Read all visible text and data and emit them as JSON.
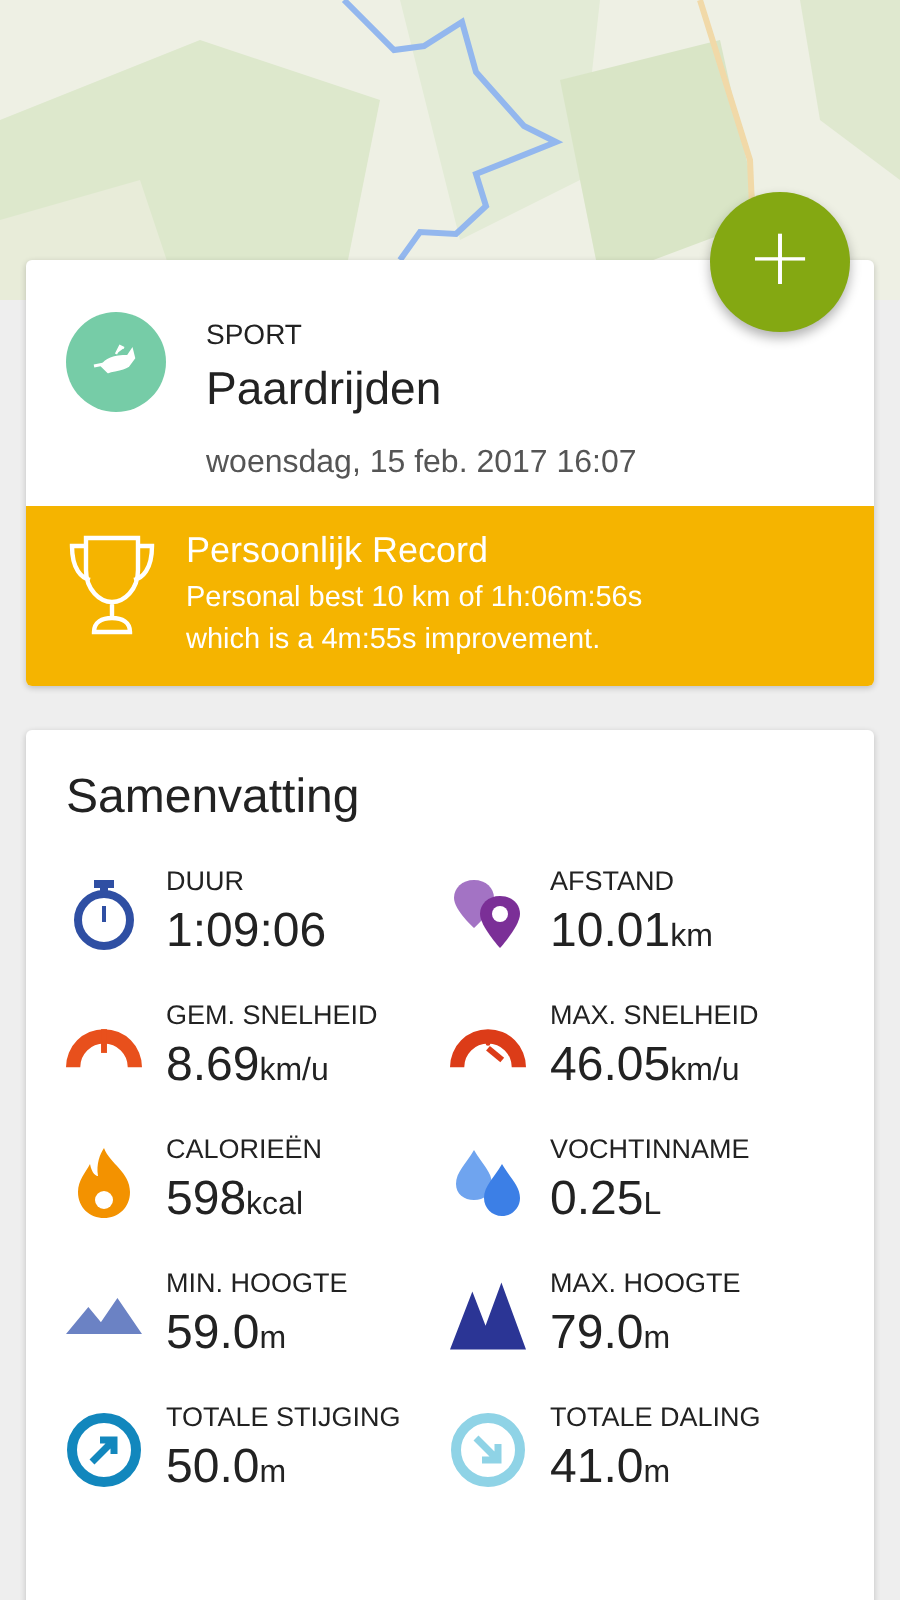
{
  "fab": {
    "symbol": "+"
  },
  "activity": {
    "label": "SPORT",
    "sport": "Paardrijden",
    "date": "woensdag, 15 feb. 2017 16:07"
  },
  "record": {
    "title": "Persoonlijk Record",
    "text": "Personal best 10 km of 1h:06m:56s which is a 4m:55s improvement."
  },
  "summary": {
    "title": "Samenvatting",
    "stats": [
      {
        "kind": "duration",
        "label": "DUUR",
        "value": "1:09:06"
      },
      {
        "kind": "distance",
        "label": "AFSTAND",
        "value": "10.01",
        "unit": "km"
      },
      {
        "kind": "avg-speed",
        "label": "GEM. SNELHEID",
        "value": "8.69",
        "unit": "km/u"
      },
      {
        "kind": "max-speed",
        "label": "MAX. SNELHEID",
        "value": "46.05",
        "unit": "km/u"
      },
      {
        "kind": "calories",
        "label": "CALORIEËN",
        "value": "598",
        "unit": "kcal"
      },
      {
        "kind": "hydration",
        "label": "VOCHTINNAME",
        "value": "0.25",
        "unit": "L"
      },
      {
        "kind": "min-altitude",
        "label": "MIN. HOOGTE",
        "value": "59.0",
        "unit": "m"
      },
      {
        "kind": "max-altitude",
        "label": "MAX. HOOGTE",
        "value": "79.0",
        "unit": "m"
      },
      {
        "kind": "ascent",
        "label": "TOTALE STIJGING",
        "value": "50.0",
        "unit": "m"
      },
      {
        "kind": "descent",
        "label": "TOTALE DALING",
        "value": "41.0",
        "unit": "m"
      }
    ]
  }
}
